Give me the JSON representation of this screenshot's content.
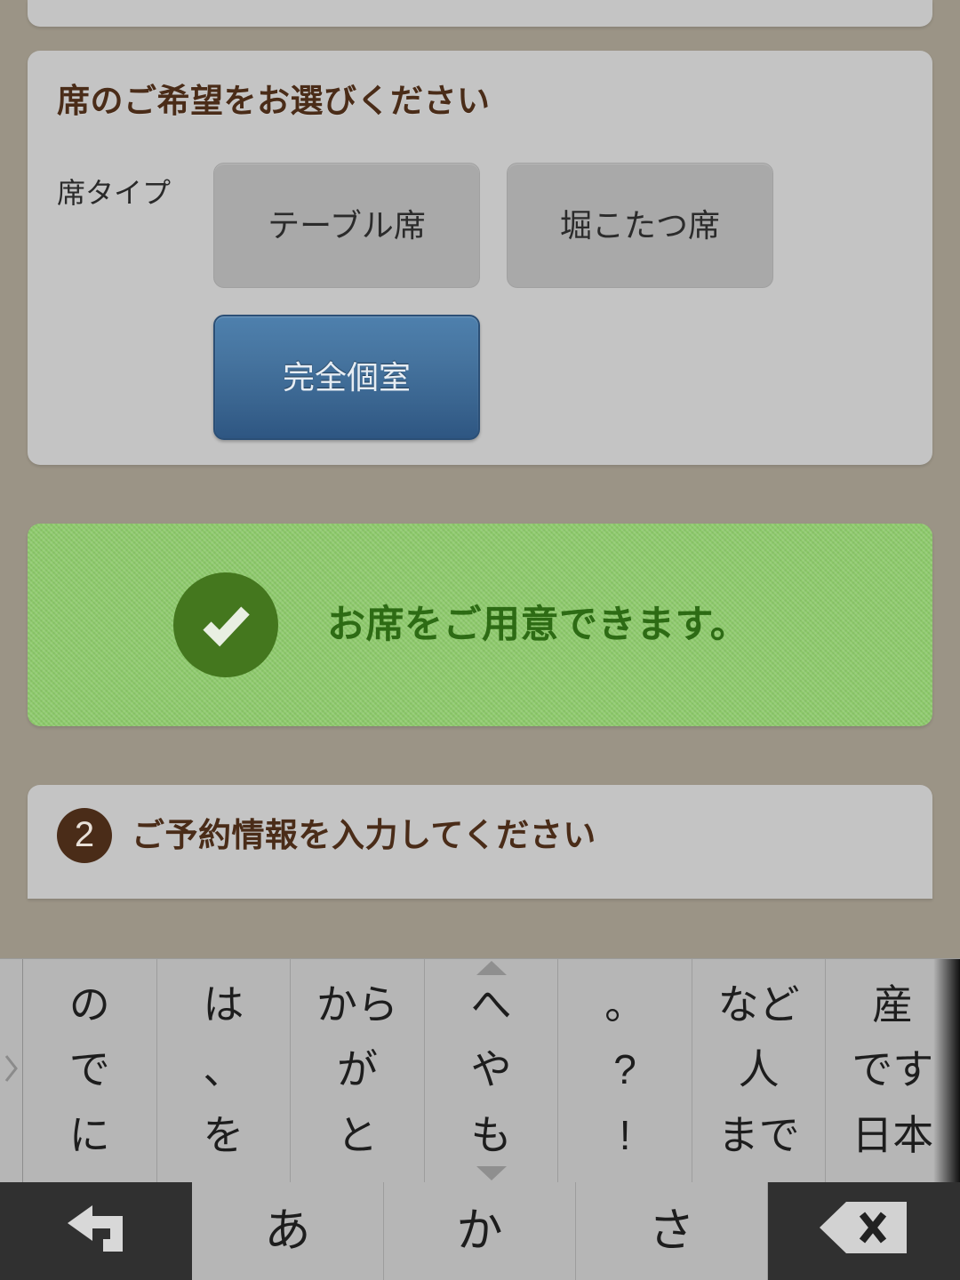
{
  "theme": {
    "page_background": "#9b9486",
    "card_background": "#c4c4c4",
    "heading_color": "#4a2c18",
    "selected_button_top": "#4e80ad",
    "selected_button_bottom": "#2e5682",
    "unselected_button": "#a9a9a9",
    "banner_background": "#8cc96a",
    "banner_text_color": "#2d6b14",
    "banner_icon_color": "#44771e",
    "keyboard_key_light": "#b6b6b6",
    "keyboard_key_dark": "#303030"
  },
  "seat_section": {
    "title": "席のご希望をお選びください",
    "field_label": "席タイプ",
    "options": [
      {
        "label": "テーブル席",
        "selected": false
      },
      {
        "label": "堀こたつ席",
        "selected": false
      },
      {
        "label": "完全個室",
        "selected": true
      }
    ]
  },
  "availability_banner": {
    "icon": "check-circle-icon",
    "message": "お席をご用意できます。"
  },
  "step_section": {
    "step_number": "2",
    "title": "ご予約情報を入力してください"
  },
  "keyboard": {
    "left_handle_icon": "chevron-right-icon",
    "suggestion_columns": [
      {
        "lines": [
          "の",
          "で",
          "に"
        ],
        "arrow_up": false,
        "arrow_down": false
      },
      {
        "lines": [
          "は",
          "、",
          "を"
        ],
        "arrow_up": false,
        "arrow_down": false
      },
      {
        "lines": [
          "から",
          "が",
          "と"
        ],
        "arrow_up": false,
        "arrow_down": false
      },
      {
        "lines": [
          "へ",
          "や",
          "も"
        ],
        "arrow_up": true,
        "arrow_down": true
      },
      {
        "lines": [
          "。",
          "?",
          "!"
        ],
        "arrow_up": false,
        "arrow_down": false
      },
      {
        "lines": [
          "など",
          "人",
          "まで"
        ],
        "arrow_up": false,
        "arrow_down": false
      },
      {
        "lines": [
          "産",
          "です",
          "日本"
        ],
        "arrow_up": false,
        "arrow_down": false
      }
    ],
    "bottom_row": [
      {
        "name": "undo-key",
        "icon": "undo-arrow-icon",
        "label": "",
        "style": "dark"
      },
      {
        "name": "kana-key-a",
        "icon": "",
        "label": "あ",
        "style": "light"
      },
      {
        "name": "kana-key-ka",
        "icon": "",
        "label": "か",
        "style": "light"
      },
      {
        "name": "kana-key-sa",
        "icon": "",
        "label": "さ",
        "style": "light"
      },
      {
        "name": "backspace-key",
        "icon": "backspace-icon",
        "label": "",
        "style": "dark"
      }
    ]
  }
}
